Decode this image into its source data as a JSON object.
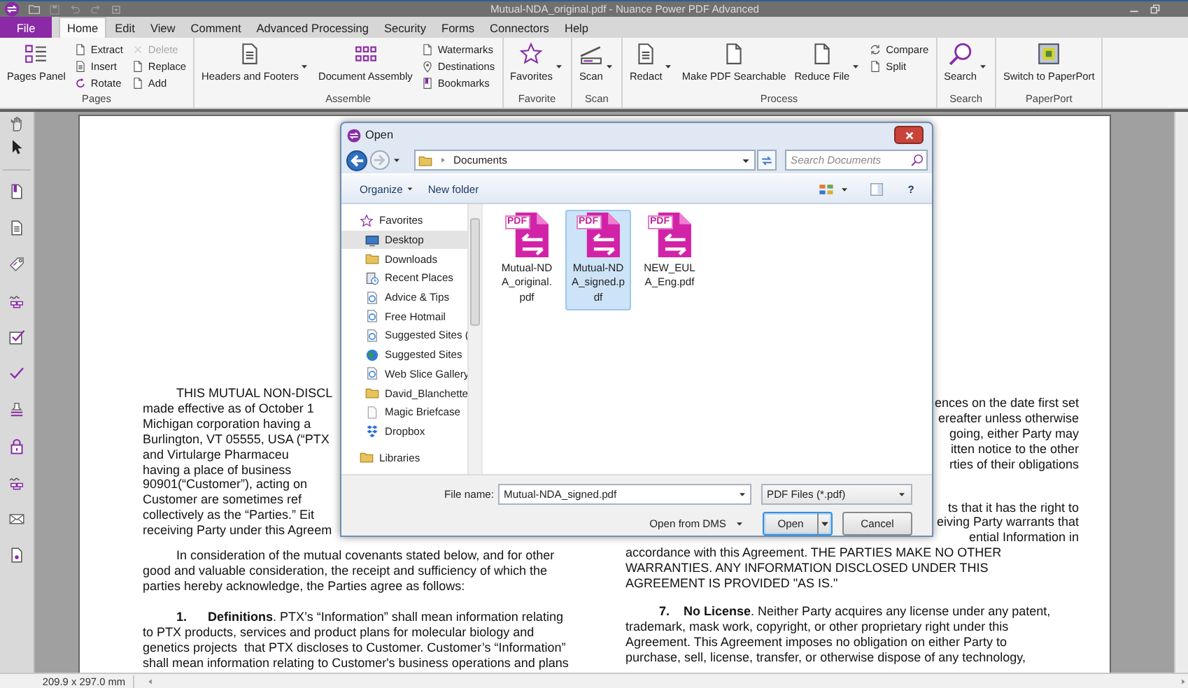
{
  "window": {
    "title": "Mutual-NDA_original.pdf - Nuance Power PDF Advanced"
  },
  "menu_tabs": [
    {
      "label": "File",
      "kind": "file",
      "selected": false
    },
    {
      "label": "Home",
      "kind": "tab",
      "selected": true
    },
    {
      "label": "Edit",
      "kind": "tab",
      "selected": false
    },
    {
      "label": "View",
      "kind": "tab",
      "selected": false
    },
    {
      "label": "Comment",
      "kind": "tab",
      "selected": false
    },
    {
      "label": "Advanced Processing",
      "kind": "tab",
      "selected": false
    },
    {
      "label": "Security",
      "kind": "tab",
      "selected": false
    },
    {
      "label": "Forms",
      "kind": "tab",
      "selected": false
    },
    {
      "label": "Connectors",
      "kind": "tab",
      "selected": false
    },
    {
      "label": "Help",
      "kind": "tab",
      "selected": false
    }
  ],
  "ribbon_groups": [
    {
      "label": "Pages",
      "items": [
        {
          "kind": "large",
          "label": "Pages Panel",
          "dropdown": false,
          "disabled": false
        },
        {
          "kind": "stack",
          "buttons": [
            {
              "label": "Extract",
              "disabled": false
            },
            {
              "label": "Insert",
              "disabled": false
            },
            {
              "label": "Rotate",
              "disabled": false
            }
          ]
        },
        {
          "kind": "stack",
          "buttons": [
            {
              "label": "Delete",
              "disabled": true
            },
            {
              "label": "Replace",
              "disabled": false
            },
            {
              "label": "Add",
              "disabled": false
            }
          ]
        }
      ]
    },
    {
      "label": "Assemble",
      "items": [
        {
          "kind": "large",
          "label": "Headers and Footers",
          "dropdown": true,
          "disabled": false
        },
        {
          "kind": "large",
          "label": "Document Assembly",
          "dropdown": false,
          "disabled": false
        },
        {
          "kind": "stack",
          "buttons": [
            {
              "label": "Watermarks",
              "disabled": false
            },
            {
              "label": "Destinations",
              "disabled": false
            },
            {
              "label": "Bookmarks",
              "disabled": false
            }
          ]
        }
      ]
    },
    {
      "label": "Favorite",
      "items": [
        {
          "kind": "large",
          "label": "Favorites",
          "dropdown": true,
          "disabled": false
        }
      ]
    },
    {
      "label": "Scan",
      "items": [
        {
          "kind": "large",
          "label": "Scan",
          "dropdown": true,
          "disabled": false
        }
      ]
    },
    {
      "label": "Process",
      "items": [
        {
          "kind": "large",
          "label": "Redact",
          "dropdown": true,
          "disabled": false
        },
        {
          "kind": "large",
          "label": "Make PDF Searchable",
          "dropdown": false,
          "disabled": false
        },
        {
          "kind": "large",
          "label": "Reduce File",
          "dropdown": true,
          "disabled": false
        },
        {
          "kind": "stack",
          "buttons": [
            {
              "label": "Compare",
              "disabled": false
            },
            {
              "label": "Split",
              "disabled": false
            }
          ]
        }
      ]
    },
    {
      "label": "Search",
      "items": [
        {
          "kind": "large",
          "label": "Search",
          "dropdown": true,
          "disabled": false
        }
      ]
    },
    {
      "label": "PaperPort",
      "items": [
        {
          "kind": "large",
          "label": "Switch to PaperPort",
          "dropdown": false,
          "disabled": false
        }
      ]
    }
  ],
  "document": {
    "columns": [
      {
        "paragraphs": [
          {
            "kind": "indented",
            "lines": [
              "THIS MUTUAL NON-DISCL",
              "made effective as of October 1",
              "Michigan corporation having a",
              "Burlington, VT 05555, USA (“PTX",
              "and Virtularge Pharmaceu",
              "having a place of business",
              "90901(“Customer”), acting on",
              "Customer are sometimes ref",
              "collectively as the “Parties.” Eit",
              "receiving Party under this Agreem"
            ]
          },
          {
            "kind": "indented",
            "lines": [
              "In consideration of the mutual covenants stated below, and for other",
              "good and valuable consideration, the receipt and sufficiency of which the",
              "parties hereby acknowledge, the Parties agree as follows:"
            ]
          },
          {
            "kind": "indented",
            "lines": [
              "**1.**      **Definitions**. PTX’s “Information” shall mean information relating",
              "to PTX products, services and product plans for molecular biology and",
              "genetics projects  that PTX discloses to Customer. Customer’s “Information”",
              "shall mean information relating to Customer's business operations and plans"
            ]
          }
        ]
      },
      {
        "paragraphs": [
          {
            "kind": "tail",
            "lines": [
              "ences on the date first set",
              "ereafter unless otherwise",
              "going, either Party may",
              "itten notice to the other",
              "rties of their obligations"
            ]
          },
          {
            "kind": "tail",
            "lines": [
              "ts that it has the right to",
              "eiving Party warrants that",
              "ential Information in"
            ]
          },
          {
            "kind": "continued",
            "lines": [
              "accordance with this Agreement. THE PARTIES MAKE NO OTHER",
              "WARRANTIES. ANY INFORMATION DISCLOSED UNDER THIS",
              "AGREEMENT IS PROVIDED \"AS IS.\""
            ]
          },
          {
            "kind": "indented",
            "lines": [
              "**7.**    **No License**. Neither Party acquires any license under any patent,",
              "trademark, mask work, copyright, or other proprietary right under this",
              "Agreement. This Agreement imposes no obligation on either Party to",
              "purchase, sell, license, transfer, or otherwise dispose of any technology,"
            ]
          }
        ]
      }
    ]
  },
  "open_dialog": {
    "title": "Open",
    "location": "Documents",
    "search": {
      "placeholder": "Search Documents"
    },
    "toolbar": [
      {
        "label": "Organize",
        "dropdown": true
      },
      {
        "label": "New folder",
        "dropdown": false
      }
    ],
    "help_button": "?",
    "nav_items": [
      {
        "label": "Favorites",
        "kind": "group",
        "selected": false
      },
      {
        "label": "Desktop",
        "kind": "item",
        "selected": true
      },
      {
        "label": "Downloads",
        "kind": "item",
        "selected": false
      },
      {
        "label": "Recent Places",
        "kind": "item",
        "selected": false
      },
      {
        "label": "Advice & Tips",
        "kind": "item",
        "selected": false
      },
      {
        "label": "Free Hotmail",
        "kind": "item",
        "selected": false
      },
      {
        "label": "Suggested Sites (",
        "kind": "item",
        "selected": false
      },
      {
        "label": "Suggested Sites",
        "kind": "item",
        "selected": false
      },
      {
        "label": "Web Slice Gallery",
        "kind": "item",
        "selected": false
      },
      {
        "label": "David_Blanchette",
        "kind": "item",
        "selected": false
      },
      {
        "label": "Magic Briefcase",
        "kind": "item",
        "selected": false
      },
      {
        "label": "Dropbox",
        "kind": "item",
        "selected": false
      },
      {
        "label": "Libraries",
        "kind": "group",
        "selected": false
      }
    ],
    "files": [
      {
        "name": "Mutual-NDA_original.pdf",
        "type_label": "PDF",
        "selected": false
      },
      {
        "name": "Mutual-NDA_signed.pdf",
        "type_label": "PDF",
        "selected": true
      },
      {
        "name": "NEW_EULA_Eng.pdf",
        "type_label": "PDF",
        "selected": false
      }
    ],
    "file_name": {
      "label": "File name:",
      "value": "Mutual-NDA_signed.pdf"
    },
    "file_type": "PDF Files (*.pdf)",
    "open_from_dms": "Open from DMS",
    "buttons": [
      {
        "label": "Open",
        "kind": "split",
        "focused": true
      },
      {
        "label": "Cancel",
        "kind": "plain",
        "focused": false
      }
    ]
  },
  "status_bar": {
    "page_size": "209.9 x 297.0 mm"
  }
}
